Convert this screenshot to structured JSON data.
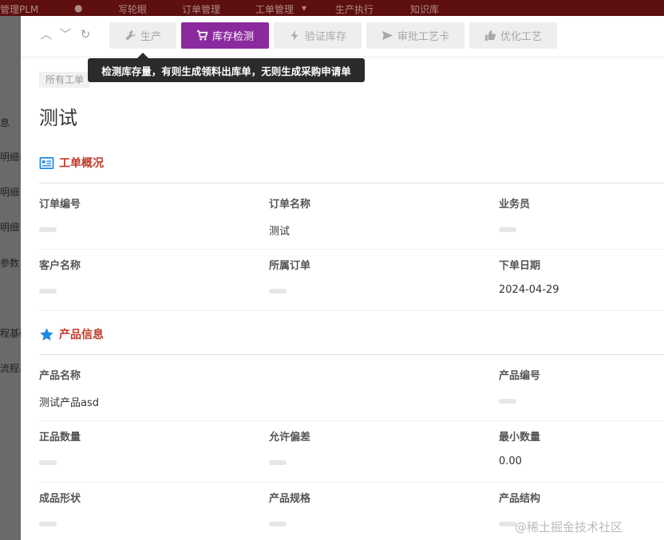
{
  "topbar": {
    "app_name": "管理PLM",
    "menu": [
      "写轮眼",
      "订单管理",
      "工单管理",
      "生产执行",
      "知识库"
    ]
  },
  "left_menu": [
    "息",
    "明细表",
    "明细",
    "明细",
    "参数",
    "程基础",
    "流程基"
  ],
  "toolbar": {
    "buttons": [
      {
        "label": "生产",
        "icon": "wrench-icon"
      },
      {
        "label": "库存检测",
        "icon": "cart-icon"
      },
      {
        "label": "验证库存",
        "icon": "bolt-icon"
      },
      {
        "label": "审批工艺卡",
        "icon": "send-icon"
      },
      {
        "label": "优化工艺",
        "icon": "thumbs-up-icon"
      }
    ],
    "tooltip": "检测库存量，有则生成领料出库单，无则生成采购申请单"
  },
  "breadcrumb": "所有工单",
  "page_title": "测试",
  "sections": {
    "overview": {
      "title": "工单概况",
      "fields": {
        "order_no": {
          "label": "订单编号",
          "value": ""
        },
        "order_name": {
          "label": "订单名称",
          "value": "测试"
        },
        "salesperson": {
          "label": "业务员",
          "value": ""
        },
        "customer": {
          "label": "客户名称",
          "value": ""
        },
        "parent_order": {
          "label": "所属订单",
          "value": ""
        },
        "order_date": {
          "label": "下单日期",
          "value": "2024-04-29"
        }
      }
    },
    "product": {
      "title": "产品信息",
      "fields": {
        "product_name": {
          "label": "产品名称",
          "value": "测试产品asd"
        },
        "product_no": {
          "label": "产品编号",
          "value": ""
        },
        "qty": {
          "label": "正品数量",
          "value": ""
        },
        "tolerance": {
          "label": "允许偏差",
          "value": ""
        },
        "min_qty": {
          "label": "最小数量",
          "value": "0.00"
        },
        "shape": {
          "label": "成品形状",
          "value": ""
        },
        "spec": {
          "label": "产品规格",
          "value": ""
        },
        "structure": {
          "label": "产品结构",
          "value": ""
        }
      }
    }
  },
  "watermark": "@稀土掘金技术社区",
  "colors": {
    "primary": "#8b2a9e",
    "section_title": "#c0392b",
    "section_icon": "#1e88e5"
  }
}
